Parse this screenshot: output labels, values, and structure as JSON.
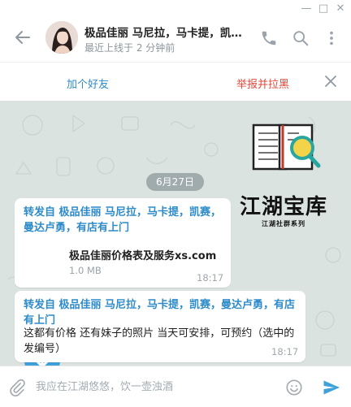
{
  "window": {
    "minimize_glyph": "—",
    "maximize_glyph": "□",
    "close_glyph": "✕"
  },
  "header": {
    "title": "极品佳丽 马尼拉，马卡提，凯赛…",
    "status": "最近上线于 2 分钟前",
    "icons": [
      "back-arrow-icon",
      "phone-icon",
      "search-icon",
      "more-vertical-icon"
    ]
  },
  "actions": {
    "add_contact": "加个好友",
    "report_block": "举报并拉黑",
    "close_icon": "close-icon"
  },
  "chat": {
    "logo_title": "江湖宝库",
    "logo_subtitle": "江湖社群系列",
    "date_badge": "6月27日",
    "messages": [
      {
        "forward_header": "转发自 极品佳丽 马尼拉，马卡提，凯赛，曼达卢勇，有店有上门",
        "file_name": "极品佳丽价格表及服务xs.com",
        "file_size": "1.0 MB",
        "time": "18:17"
      },
      {
        "forward_header": "转发自 极品佳丽 马尼拉，马卡提，凯赛，曼达卢勇，有店有上门",
        "text": "这都有价格 还有妹子的照片 当天可安排，可预约（选中的发编号）",
        "time": "18:17"
      }
    ]
  },
  "input": {
    "placeholder": "我应在江湖悠悠，饮一壶浊酒",
    "value": ""
  },
  "colors": {
    "accent": "#2e8bc9",
    "danger": "#e2483b",
    "chat_background": "#dbe3e1",
    "file_icon": "#3ea1da",
    "send": "#3ea1da"
  }
}
